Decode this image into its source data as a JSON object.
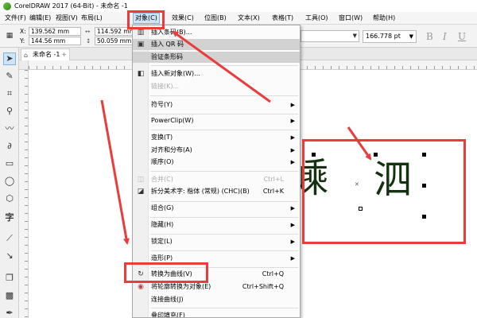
{
  "window": {
    "title": "CorelDRAW 2017 (64-Bit) - 未命名 -1"
  },
  "menubar": {
    "items": [
      {
        "label": "文件(F)"
      },
      {
        "label": "编辑(E)"
      },
      {
        "label": "视图(V)"
      },
      {
        "label": "布局(L)"
      },
      {
        "label": "对象(C)"
      },
      {
        "label": "效果(C)"
      },
      {
        "label": "位图(B)"
      },
      {
        "label": "文本(X)"
      },
      {
        "label": "表格(T)"
      },
      {
        "label": "工具(O)"
      },
      {
        "label": "窗口(W)"
      },
      {
        "label": "帮助(H)"
      }
    ],
    "active_index": 4
  },
  "propbar": {
    "x_label": "X:",
    "x_value": "139.562 mm",
    "y_label": "Y:",
    "y_value": "144.56 mm",
    "w_value": "114.592 mm",
    "h_value": "50.059 mm",
    "font_size": "166.778 pt"
  },
  "document_tab": {
    "label": "未命名 -1"
  },
  "object_menu": {
    "items": [
      {
        "label": "插入条码(B)...",
        "icon": "barcode-icon",
        "shortcut": "",
        "submenu": false,
        "disabled": false,
        "highlight": false
      },
      {
        "label": "插入 QR 码",
        "icon": "qr-icon",
        "shortcut": "",
        "submenu": false,
        "disabled": false,
        "highlight": true
      },
      {
        "label": "验证条形码",
        "icon": "",
        "shortcut": "",
        "submenu": false,
        "disabled": false,
        "highlight": true
      },
      {
        "label": "插入新对象(W)...",
        "icon": "insert-object-icon",
        "shortcut": "",
        "submenu": false,
        "disabled": false,
        "highlight": false
      },
      {
        "label": "链接(K)...",
        "icon": "",
        "shortcut": "",
        "submenu": false,
        "disabled": true,
        "highlight": false
      },
      {
        "label": "符号(Y)",
        "icon": "",
        "shortcut": "",
        "submenu": true,
        "disabled": false,
        "highlight": false
      },
      {
        "label": "PowerClip(W)",
        "icon": "",
        "shortcut": "",
        "submenu": true,
        "disabled": false,
        "highlight": false
      },
      {
        "label": "变换(T)",
        "icon": "",
        "shortcut": "",
        "submenu": true,
        "disabled": false,
        "highlight": false
      },
      {
        "label": "对齐和分布(A)",
        "icon": "",
        "shortcut": "",
        "submenu": true,
        "disabled": false,
        "highlight": false
      },
      {
        "label": "顺序(O)",
        "icon": "",
        "shortcut": "",
        "submenu": true,
        "disabled": false,
        "highlight": false
      },
      {
        "label": "合并(C)",
        "icon": "combine-icon",
        "shortcut": "Ctrl+L",
        "submenu": false,
        "disabled": true,
        "highlight": false
      },
      {
        "label": "拆分美术字: 楷体 (常规) (CHC)(B)",
        "icon": "break-apart-icon",
        "shortcut": "Ctrl+K",
        "submenu": false,
        "disabled": false,
        "highlight": false
      },
      {
        "label": "组合(G)",
        "icon": "",
        "shortcut": "",
        "submenu": true,
        "disabled": false,
        "highlight": false
      },
      {
        "label": "隐藏(H)",
        "icon": "",
        "shortcut": "",
        "submenu": true,
        "disabled": false,
        "highlight": false
      },
      {
        "label": "锁定(L)",
        "icon": "",
        "shortcut": "",
        "submenu": true,
        "disabled": false,
        "highlight": false
      },
      {
        "label": "造形(P)",
        "icon": "",
        "shortcut": "",
        "submenu": true,
        "disabled": false,
        "highlight": false
      },
      {
        "label": "转换为曲线(V)",
        "icon": "convert-to-curves-icon",
        "shortcut": "Ctrl+Q",
        "submenu": false,
        "disabled": false,
        "highlight": false
      },
      {
        "label": "将轮廓转换为对象(E)",
        "icon": "outline-to-object-icon",
        "shortcut": "Ctrl+Shift+Q",
        "submenu": false,
        "disabled": false,
        "highlight": false
      },
      {
        "label": "连接曲线(J)",
        "icon": "",
        "shortcut": "",
        "submenu": false,
        "disabled": false,
        "highlight": false
      },
      {
        "label": "叠印填充(F)",
        "icon": "",
        "shortcut": "",
        "submenu": false,
        "disabled": false,
        "highlight": false
      }
    ]
  },
  "canvas": {
    "text_left": "嵊",
    "text_right": "泗"
  },
  "colors": {
    "annotation_red": "#ea3c3c",
    "menu_highlight": "#d2d2d2",
    "active_menu": "#cfe4f7",
    "glyph_color": "#143212"
  }
}
